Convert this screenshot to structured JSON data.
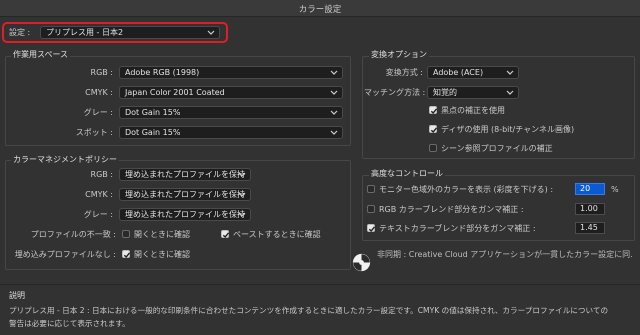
{
  "window": {
    "title": "カラー設定"
  },
  "settings": {
    "label": "設定 :",
    "value": "プリプレス用 - 日本2"
  },
  "working_spaces": {
    "title": "作業用スペース",
    "rgb": {
      "label": "RGB :",
      "value": "Adobe RGB (1998)"
    },
    "cmyk": {
      "label": "CMYK :",
      "value": "Japan Color 2001 Coated"
    },
    "gray": {
      "label": "グレー :",
      "value": "Dot Gain 15%"
    },
    "spot": {
      "label": "スポット :",
      "value": "Dot Gain 15%"
    }
  },
  "color_management": {
    "title": "カラーマネジメントポリシー",
    "rgb": {
      "label": "RGB :",
      "value": "埋め込まれたプロファイルを保持"
    },
    "cmyk": {
      "label": "CMYK :",
      "value": "埋め込まれたプロファイルを保持"
    },
    "gray": {
      "label": "グレー :",
      "value": "埋め込まれたプロファイルを保持"
    },
    "mismatch": {
      "label": "プロファイルの不一致 :",
      "ask_open": {
        "label": "開くときに確認",
        "checked": false
      },
      "ask_paste": {
        "label": "ペーストするときに確認",
        "checked": true
      }
    },
    "missing": {
      "label": "埋め込みプロファイルなし :",
      "ask_open": {
        "label": "開くときに確認",
        "checked": true
      }
    }
  },
  "conversion": {
    "title": "変換オプション",
    "engine": {
      "label": "変換方式 :",
      "value": "Adobe (ACE)"
    },
    "intent": {
      "label": "マッチング方法 :",
      "value": "知覚的"
    },
    "bpc": {
      "label": "黒点の補正を使用",
      "checked": true
    },
    "dither": {
      "label": "ディザの使用 (8-bit/チャンネル画像)",
      "checked": true
    },
    "scene": {
      "label": "シーン参照プロファイルの補正",
      "checked": false
    }
  },
  "advanced": {
    "title": "高度なコントロール",
    "desaturate": {
      "label": "モニター色域外のカラーを表示 (彩度を下げる) :",
      "checked": false,
      "value": "20",
      "unit": "%"
    },
    "blend_rgb": {
      "label": "RGB カラーブレンド部分をガンマ補正 :",
      "checked": false,
      "value": "1.00"
    },
    "blend_text": {
      "label": "テキストカラーブレンド部分をガンマ補正 :",
      "checked": true,
      "value": "1.45"
    }
  },
  "sync": {
    "text": "非同期 : Creative Cloud アプリケーションが一貫したカラー設定に同..."
  },
  "description": {
    "title": "説明",
    "line1": "プリプレス用 - 日本 2 : 日本における一般的な印刷条件に合わせたコンテンツを作成するときに適したカラー設定です。CMYK の値は保持され、カラープロファイルについての",
    "line2": "警告は必要に応じて表示されます。"
  },
  "colors": {
    "highlight_ring": "#e01e26",
    "selection": "#0a5bd3"
  }
}
